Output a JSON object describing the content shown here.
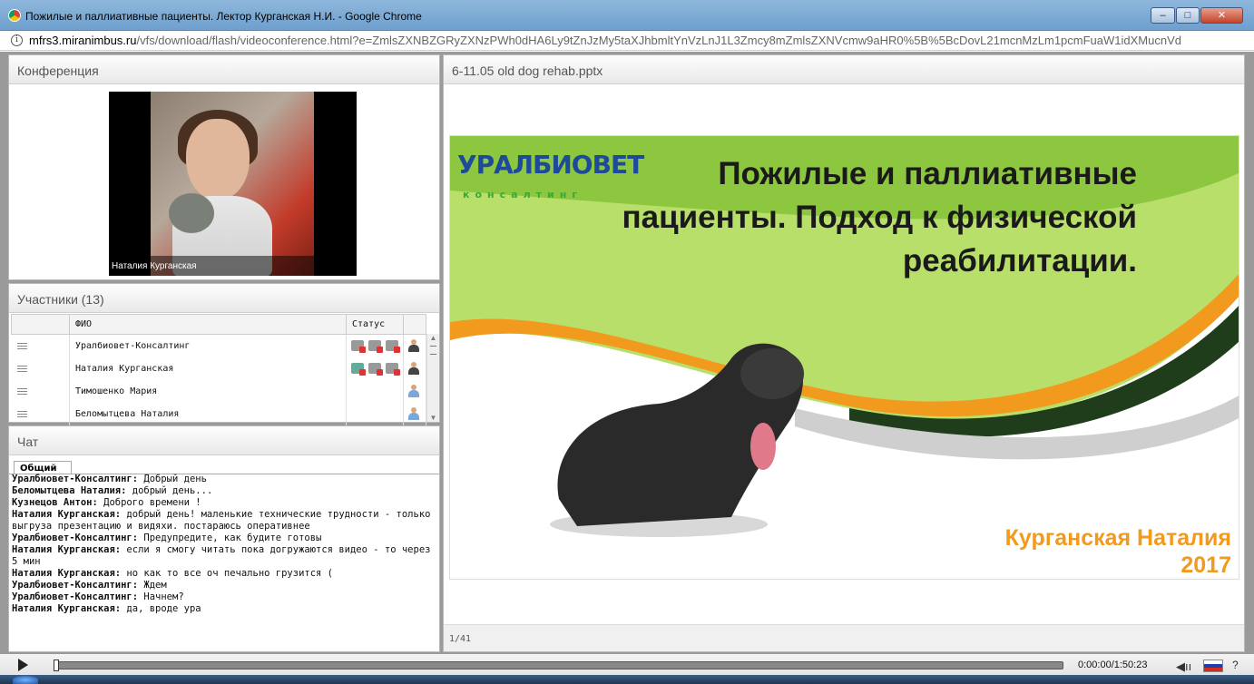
{
  "window": {
    "title": "Пожилые и паллиативные пациенты. Лектор Курганская Н.И. - Google Chrome",
    "min_symbol": "–",
    "max_symbol": "□",
    "close_symbol": "✕"
  },
  "address": {
    "domain": "mfrs3.miranimbus.ru",
    "path": "/vfs/download/flash/videoconference.html?e=ZmlsZXNBZGRyZXNzPWh0dHA6Ly9tZnJzMy5taXJhbmltYnVzLnJ1L3Zmcy8mZmlsZXNVcmw9aHR0%5B%5BcDovL21mcnMzLm1pcmFuaW1idXMucnVd"
  },
  "conference": {
    "header": "Конференция",
    "speaker_name": "Наталия Курганская"
  },
  "participants": {
    "header": "Участники (13)",
    "col_name": "ФИО",
    "col_status": "Статус",
    "rows": [
      {
        "name": "Уралбиовет-Консалтинг",
        "organizer": true,
        "mic_on": false
      },
      {
        "name": "Наталия Курганская",
        "organizer": true,
        "mic_on": true
      },
      {
        "name": "Тимошенко Мария",
        "organizer": false,
        "mic_on": false
      },
      {
        "name": "Беломытцева Наталия",
        "organizer": false,
        "mic_on": false
      }
    ]
  },
  "chat": {
    "header": "Чат",
    "tab": "Общий",
    "messages": [
      {
        "author": "Уралбиовет-Консалтинг:",
        "text": " Добрый день"
      },
      {
        "author": "Беломытцева Наталия:",
        "text": " добрый день..."
      },
      {
        "author": "Кузнецов Антон:",
        "text": " Доброго времени !"
      },
      {
        "author": "Наталия Курганская:",
        "text": " добрый день! маленькие технические трудности - только выгруза презентацию и видяхи. постараюсь оперативнее"
      },
      {
        "author": "Уралбиовет-Консалтинг:",
        "text": " Предупредите, как будите готовы"
      },
      {
        "author": "Наталия Курганская:",
        "text": " если  я смогу читать пока догружаются видео - то через 5 мин"
      },
      {
        "author": "Наталия Курганская:",
        "text": " но как то все оч печально грузится ("
      },
      {
        "author": "Уралбиовет-Консалтинг:",
        "text": " Ждем"
      },
      {
        "author": "Уралбиовет-Консалтинг:",
        "text": " Начнем?"
      },
      {
        "author": "Наталия Курганская:",
        "text": " да, вроде ура"
      }
    ]
  },
  "presentation": {
    "header": "6-11.05 old dog rehab.pptx",
    "page": "1/41",
    "logo_top": "УРАЛБИОВЕТ",
    "logo_sub": "консалтинг",
    "slide_title_1": "Пожилые и паллиативные",
    "slide_title_2": "пациенты. Подход к физической",
    "slide_title_3": "реабилитации.",
    "author": "Курганская Наталия",
    "year": "2017"
  },
  "player": {
    "time": "0:00:00/1:50:23",
    "progress": 0.0,
    "help": "?"
  },
  "colors": {
    "slide_green": "#8dc63f",
    "slide_orange": "#f29a1e",
    "logo_green": "#3aa935",
    "logo_blue": "#1e4a9c"
  }
}
